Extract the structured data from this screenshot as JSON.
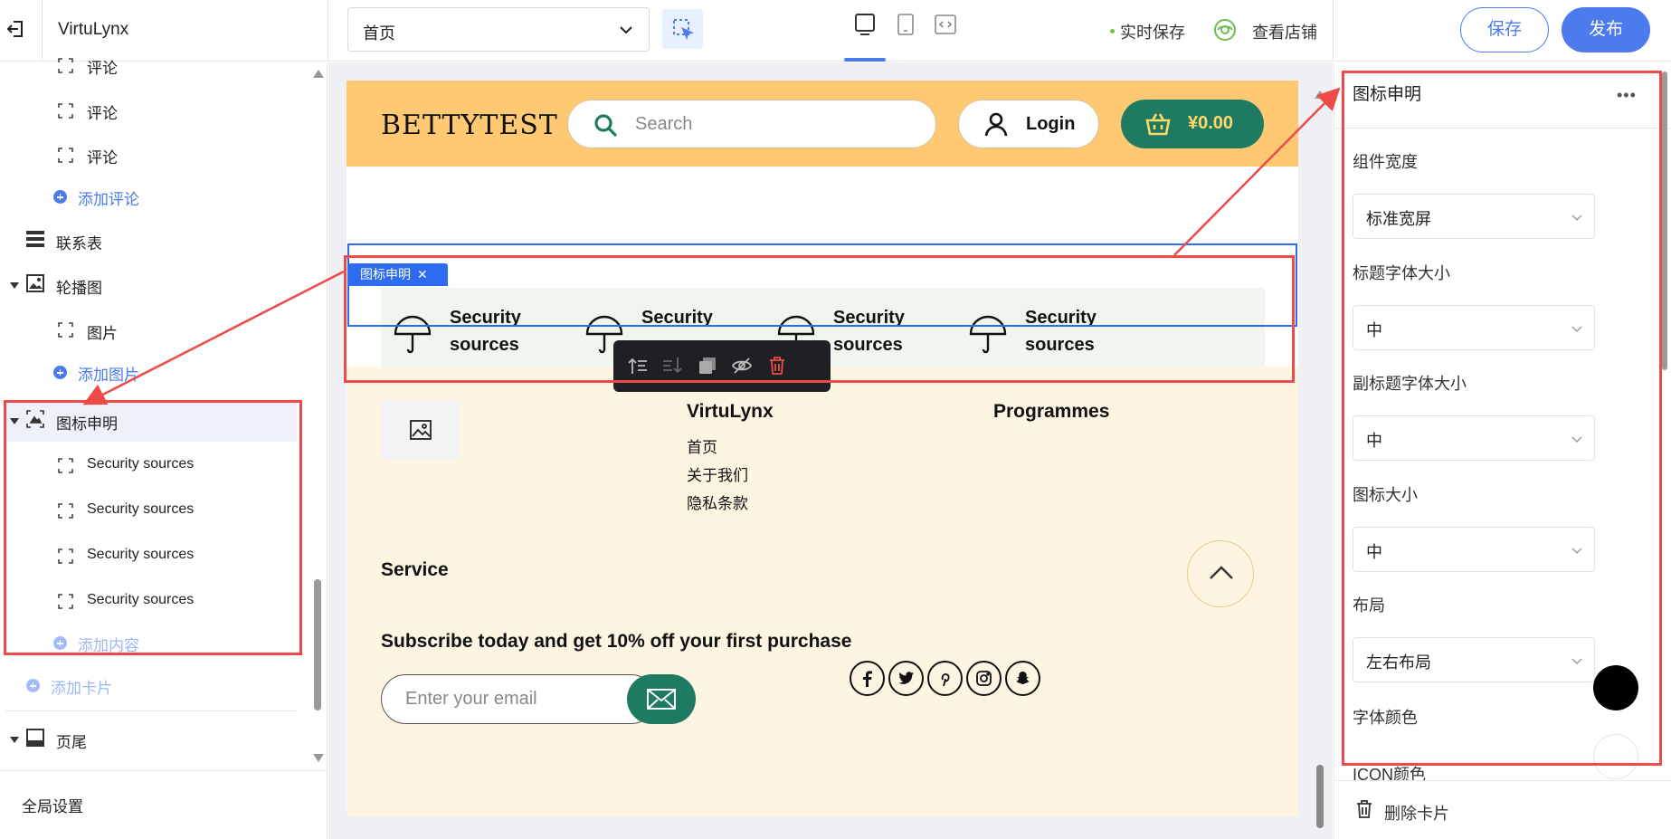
{
  "topbar": {
    "app_title": "VirtuLynx",
    "page_select": "首页",
    "autosave": "实时保存",
    "view_store": "查看店铺",
    "save": "保存",
    "publish": "发布"
  },
  "sidebar": {
    "items": [
      {
        "label": "评论"
      },
      {
        "label": "评论"
      },
      {
        "label": "评论"
      },
      {
        "label": "添加评论"
      },
      {
        "label": "联系表"
      },
      {
        "label": "轮播图"
      },
      {
        "label": "图片"
      },
      {
        "label": "添加图片"
      },
      {
        "label": "图标申明"
      },
      {
        "label": "Security sources"
      },
      {
        "label": "Security sources"
      },
      {
        "label": "Security sources"
      },
      {
        "label": "Security sources"
      },
      {
        "label": "添加内容"
      },
      {
        "label": "添加卡片"
      },
      {
        "label": "页尾"
      }
    ],
    "global_settings": "全局设置"
  },
  "store": {
    "brand": "BETTYTEST",
    "search_placeholder": "Search",
    "login": "Login",
    "cart_total": "¥0.00",
    "selected_tag": "图标申明",
    "features": [
      {
        "title": "Security sources"
      },
      {
        "title": "Security sources"
      },
      {
        "title": "Security sources"
      },
      {
        "title": "Security sources"
      }
    ],
    "footer": {
      "col1_title": "VirtuLynx",
      "col1_links": [
        "首页",
        "关于我们",
        "隐私条款"
      ],
      "col2_title": "Programmes",
      "service": "Service",
      "subscribe": "Subscribe today and get 10% off your first purchase",
      "email_placeholder": "Enter your email",
      "socials": [
        "facebook-icon",
        "twitter-icon",
        "pinterest-icon",
        "instagram-icon",
        "snapchat-icon"
      ]
    }
  },
  "settings": {
    "title": "图标申明",
    "more": "•••",
    "fields": [
      {
        "label": "组件宽度",
        "value": "标准宽屏"
      },
      {
        "label": "标题字体大小",
        "value": "中"
      },
      {
        "label": "副标题字体大小",
        "value": "中"
      },
      {
        "label": "图标大小",
        "value": "中"
      },
      {
        "label": "布局",
        "value": "左右布局"
      }
    ],
    "font_color_label": "字体颜色",
    "font_color": "#000000",
    "icon_color_label": "ICON颜色",
    "icon_color": "#ffffff",
    "delete_card": "删除卡片"
  },
  "colors": {
    "accent": "#4b7bec",
    "header_bg": "#ffc872",
    "cart_green": "#1f7a62",
    "annotation_red": "#ef4a4a"
  }
}
